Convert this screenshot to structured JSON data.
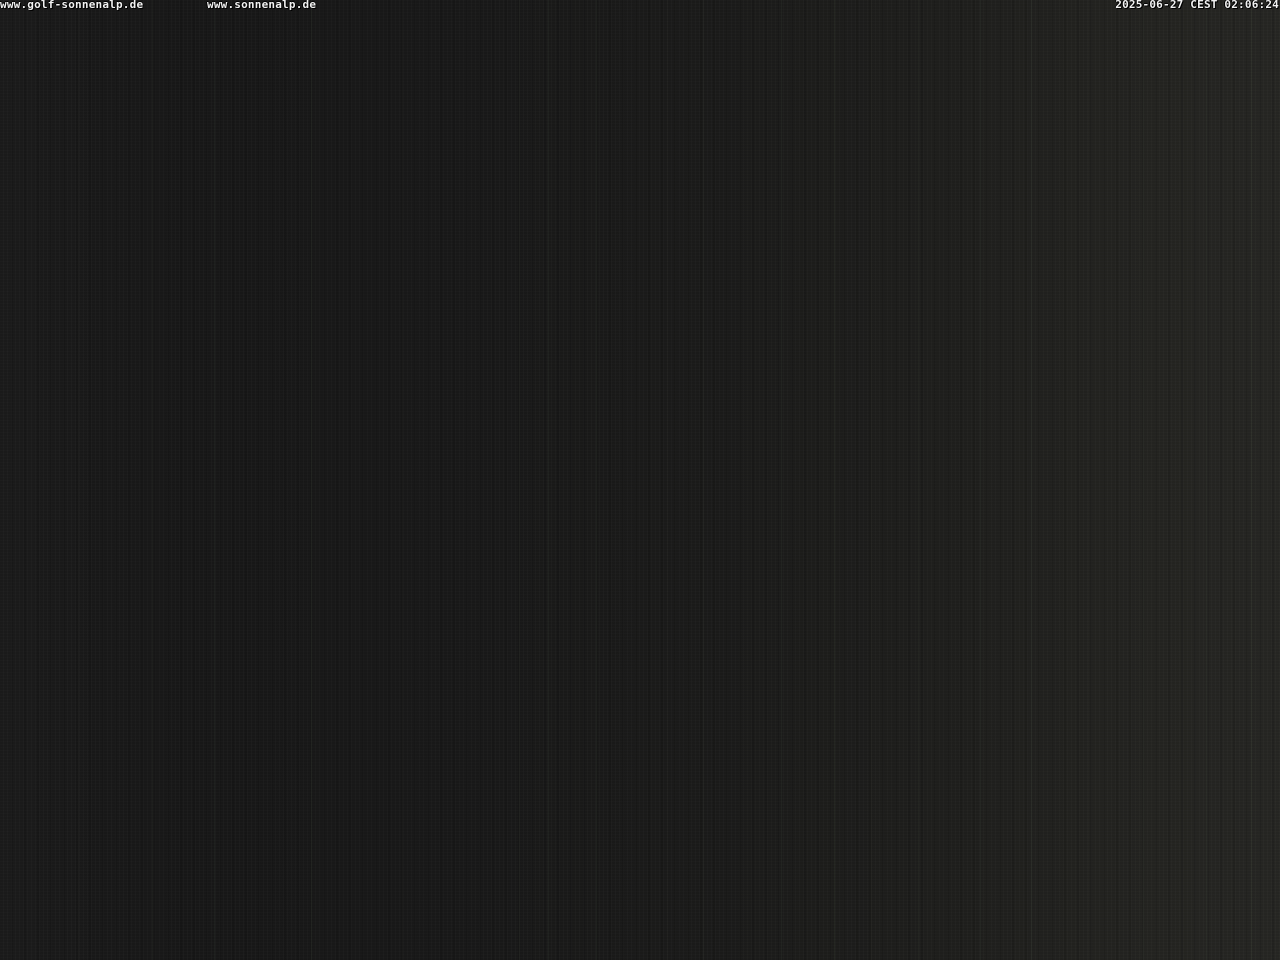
{
  "overlay": {
    "url_primary": "www.golf-sonnenalp.de",
    "url_secondary": "www.sonnenalp.de",
    "timestamp": "2025-06-27 CEST 02:06:24"
  },
  "image": {
    "subject": "night-webcam-frame",
    "colors": {
      "base": "#1b1b1b",
      "text": "#f2f2f2"
    }
  }
}
